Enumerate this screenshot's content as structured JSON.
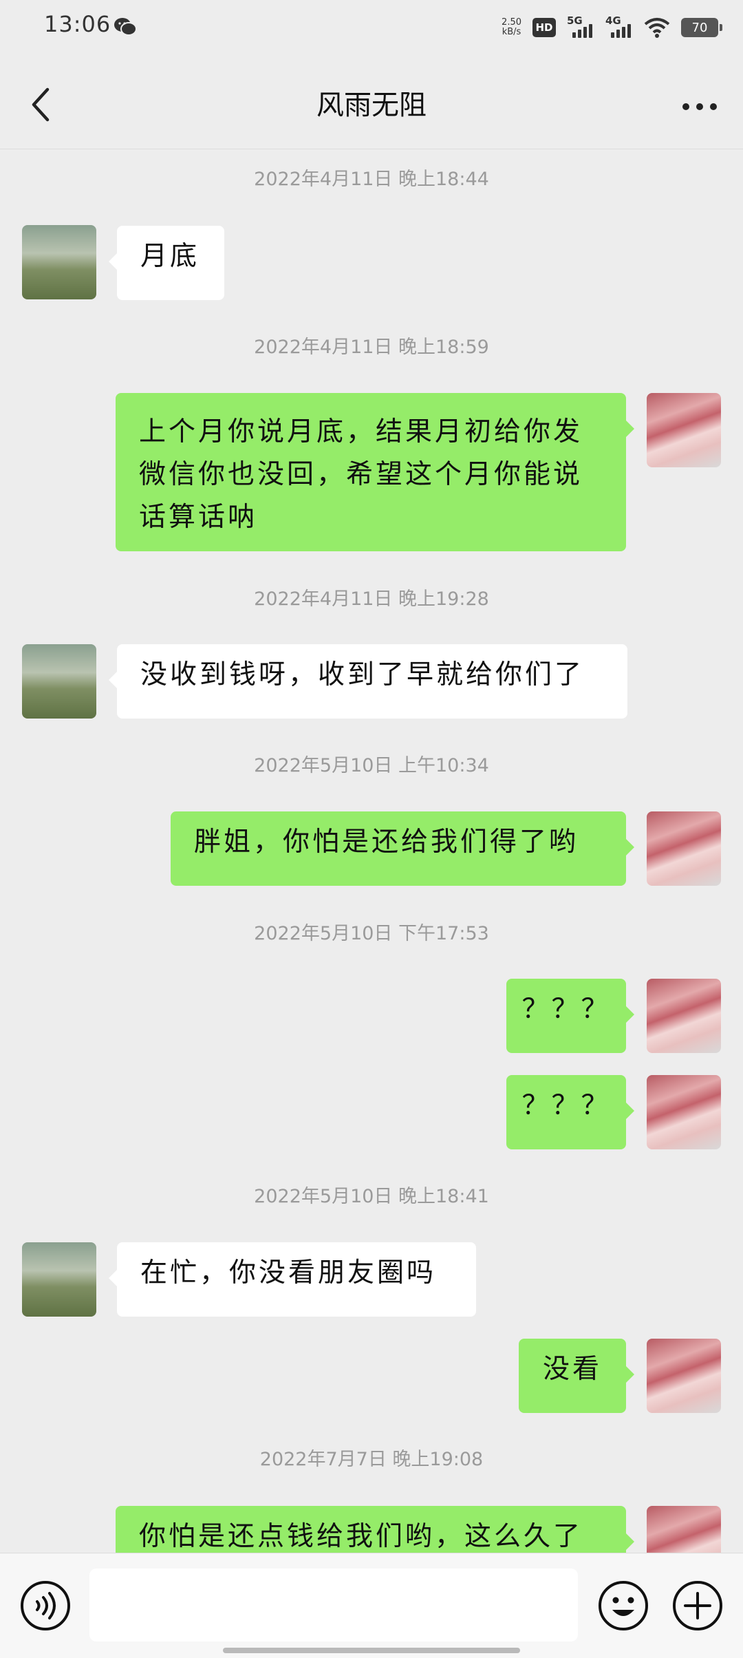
{
  "status_bar": {
    "time": "13:06",
    "net_speed_value": "2.50",
    "net_speed_unit": "kB/s",
    "hd_label": "HD",
    "sim1_label": "5G",
    "sim2_label": "4G",
    "battery": "70",
    "wechat_icon": "wechat-icon",
    "wifi_icon": "wifi-icon"
  },
  "header": {
    "title": "风雨无阻",
    "back_icon": "chevron-left-icon",
    "more_icon": "more-dots-icon"
  },
  "messages": [
    {
      "type": "time",
      "text": "2022年4月11日 晚上18:44"
    },
    {
      "type": "msg",
      "side": "in",
      "text": "月底"
    },
    {
      "type": "time",
      "text": "2022年4月11日 晚上18:59"
    },
    {
      "type": "msg",
      "side": "out",
      "lines": [
        "上个月你说月底，结果月初给你发",
        "微信你也没回，希望这个月你能说",
        "话算话呐"
      ]
    },
    {
      "type": "time",
      "text": "2022年4月11日 晚上19:28"
    },
    {
      "type": "msg",
      "side": "in",
      "text": "没收到钱呀，收到了早就给你们了"
    },
    {
      "type": "time",
      "text": "2022年5月10日 上午10:34"
    },
    {
      "type": "msg",
      "side": "out",
      "text": "胖姐，你怕是还给我们得了哟"
    },
    {
      "type": "time",
      "text": "2022年5月10日 下午17:53"
    },
    {
      "type": "msg",
      "side": "out",
      "text": "？？？"
    },
    {
      "type": "msg",
      "side": "out",
      "text": "？？？"
    },
    {
      "type": "time",
      "text": "2022年5月10日 晚上18:41"
    },
    {
      "type": "msg",
      "side": "in",
      "text": "在忙，你没看朋友圈吗"
    },
    {
      "type": "msg",
      "side": "out",
      "text": "没看"
    },
    {
      "type": "time",
      "text": "2022年7月7日 晚上19:08"
    },
    {
      "type": "msg",
      "side": "out",
      "text": "你怕是还点钱给我们哟，这么久了"
    }
  ],
  "input_bar": {
    "placeholder": "",
    "voice_icon": "voice-icon",
    "emoji_icon": "emoji-icon",
    "plus_icon": "plus-icon"
  },
  "colors": {
    "background": "#ededed",
    "outgoing_bubble": "#95ec69",
    "incoming_bubble": "#ffffff",
    "timestamp_text": "#9a9a9a"
  }
}
